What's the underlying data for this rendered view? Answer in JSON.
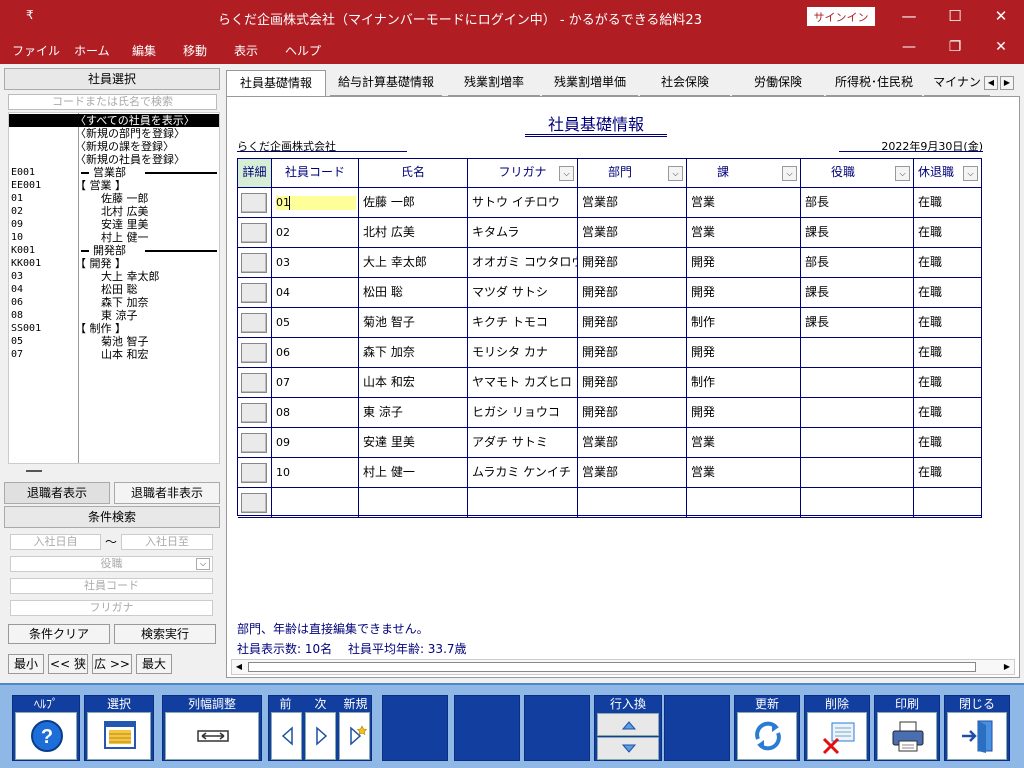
{
  "window": {
    "title": "らくだ企画株式会社（マイナンバーモードにログイン中） - かるがるできる給料23",
    "sysmenu": "₹",
    "signin": "サインイン",
    "minimize": "—",
    "maximize": "☐",
    "close": "✕"
  },
  "menu": {
    "items": [
      "ファイル",
      "ホーム",
      "編集",
      "移動",
      "表示",
      "ヘルプ"
    ],
    "buttons": [
      "—",
      "❐",
      "✕"
    ]
  },
  "left": {
    "title": "社員選択",
    "search_placeholder": "コードまたは氏名で検索",
    "tree": [
      {
        "code": "",
        "name": "〈すべての社員を表示〉",
        "selected": true
      },
      {
        "code": "",
        "name": "〈新規の部門を登録〉"
      },
      {
        "code": "",
        "name": "〈新規の課を登録〉"
      },
      {
        "code": "",
        "name": "〈新規の社員を登録〉"
      },
      {
        "code": "E001",
        "name": "営業部"
      },
      {
        "code": "EE001",
        "name": "【 営業 】"
      },
      {
        "code": "01",
        "name": "佐藤 一郎"
      },
      {
        "code": "02",
        "name": "北村 広美"
      },
      {
        "code": "09",
        "name": "安達 里美"
      },
      {
        "code": "10",
        "name": "村上 健一"
      },
      {
        "code": "K001",
        "name": "開発部"
      },
      {
        "code": "KK001",
        "name": "【 開発 】"
      },
      {
        "code": "03",
        "name": "大上 幸太郎"
      },
      {
        "code": "04",
        "name": "松田 聡"
      },
      {
        "code": "06",
        "name": "森下 加奈"
      },
      {
        "code": "08",
        "name": "東 涼子"
      },
      {
        "code": "SS001",
        "name": "【 制作 】"
      },
      {
        "code": "05",
        "name": "菊池 智子"
      },
      {
        "code": "07",
        "name": "山本 和宏"
      }
    ],
    "tab_retired_show": "退職者表示",
    "tab_retired_hide": "退職者非表示",
    "cond_title": "条件検索",
    "hire_from": "入社日自",
    "tilde": "〜",
    "hire_to": "入社日至",
    "position": "役職",
    "emp_code": "社員コード",
    "furigana": "フリガナ",
    "clear": "条件クリア",
    "run": "検索実行",
    "min": "最小",
    "narrow": "<< 狭",
    "wide": "広 >>",
    "max": "最大"
  },
  "tabs": [
    "社員基礎情報",
    "給与計算基礎情報",
    "残業割増率",
    "残業割増単価",
    "社会保険",
    "労働保険",
    "所得税･住民税",
    "マイナン"
  ],
  "tab_arrows": [
    "◀",
    "▶"
  ],
  "panel": {
    "title": "社員基礎情報",
    "company": "らくだ企画株式会社",
    "date": "2022年9月30日(金)",
    "headers": [
      "詳細",
      "社員コード",
      "氏名",
      "フリガナ",
      "部門",
      "課",
      "役職",
      "休退職"
    ],
    "dropdown_glyph": "⌵",
    "rows": [
      [
        "01",
        "佐藤 一郎",
        "サトウ イチロウ",
        "営業部",
        "営業",
        "部長",
        "在職"
      ],
      [
        "02",
        "北村 広美",
        "キタムラ",
        "営業部",
        "営業",
        "課長",
        "在職"
      ],
      [
        "03",
        "大上 幸太郎",
        "オオガミ コウタロウ",
        "開発部",
        "開発",
        "部長",
        "在職"
      ],
      [
        "04",
        "松田 聡",
        "マツダ サトシ",
        "開発部",
        "開発",
        "課長",
        "在職"
      ],
      [
        "05",
        "菊池 智子",
        "キクチ トモコ",
        "開発部",
        "制作",
        "課長",
        "在職"
      ],
      [
        "06",
        "森下 加奈",
        "モリシタ カナ",
        "開発部",
        "開発",
        "",
        "在職"
      ],
      [
        "07",
        "山本 和宏",
        "ヤマモト カズヒロ",
        "開発部",
        "制作",
        "",
        "在職"
      ],
      [
        "08",
        "東 涼子",
        "ヒガシ リョウコ",
        "開発部",
        "開発",
        "",
        "在職"
      ],
      [
        "09",
        "安達 里美",
        "アダチ サトミ",
        "営業部",
        "営業",
        "",
        "在職"
      ],
      [
        "10",
        "村上 健一",
        "ムラカミ ケンイチ",
        "営業部",
        "営業",
        "",
        "在職"
      ],
      [
        "",
        "",
        "",
        "",
        "",
        "",
        ""
      ]
    ],
    "note": "部門、年齢は直接編集できません。",
    "count": "社員表示数: 10名　 社員平均年齢: 33.7歳",
    "scroll_left": "◀",
    "scroll_right": "▶"
  },
  "toolbar": {
    "help": "ﾍﾙﾌﾟ",
    "select": "選択",
    "colwidth": "列幅調整",
    "prev": "前",
    "next": "次",
    "new": "新規",
    "row_swap": "行入換",
    "update": "更新",
    "delete": "削除",
    "print": "印刷",
    "close": "閉じる"
  },
  "colors": {
    "titlebar": "#b01e24",
    "navy": "#00007a",
    "toolbar_blue": "#123ea0",
    "toolbar_bg": "#8fb8e6",
    "highlight": "#ffff99"
  }
}
